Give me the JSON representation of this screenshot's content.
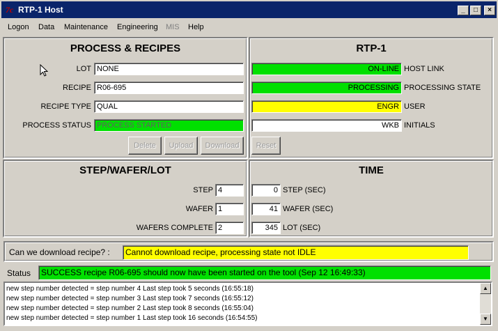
{
  "window": {
    "title": "RTP-1 Host",
    "icon_text": "7c"
  },
  "menu": [
    "Logon",
    "Data",
    "Maintenance",
    "Engineering",
    "MIS",
    "Help"
  ],
  "process": {
    "heading": "PROCESS & RECIPES",
    "lot_label": "LOT",
    "lot_value": "NONE",
    "recipe_label": "RECIPE",
    "recipe_value": "R06-695",
    "recipe_type_label": "RECIPE TYPE",
    "recipe_type_value": "QUAL",
    "status_label": "PROCESS STATUS",
    "status_value": "PROCESS STARTED",
    "delete": "Delete",
    "upload": "Upload",
    "download": "Download"
  },
  "rtp": {
    "heading": "RTP-1",
    "host_link_value": "ON-LINE",
    "host_link_label": "HOST LINK",
    "proc_state_value": "PROCESSING",
    "proc_state_label": "PROCESSING STATE",
    "user_value": "ENGR",
    "user_label": "USER",
    "initials_value": "WKB",
    "initials_label": "INITIALS",
    "reset": "Reset"
  },
  "step": {
    "heading": "STEP/WAFER/LOT",
    "step_label": "STEP",
    "step_value": "4",
    "wafer_label": "WAFER",
    "wafer_value": "1",
    "complete_label": "WAFERS COMPLETE",
    "complete_value": "2"
  },
  "time": {
    "heading": "TIME",
    "step_value": "0",
    "step_label": "STEP (SEC)",
    "wafer_value": "41",
    "wafer_label": "WAFER (SEC)",
    "lot_value": "345",
    "lot_label": "LOT (SEC)"
  },
  "download_question": {
    "label": "Can we download recipe? :",
    "value": "Cannot download recipe, processing state not IDLE"
  },
  "status": {
    "label": "Status",
    "value": "SUCCESS recipe R06-695 should now have been started on the tool (Sep 12 16:49:33)"
  },
  "log": [
    "new step number detected = step number 4  Last step took 5 seconds (16:55:18)",
    "new step number detected = step number 3  Last step took 7 seconds (16:55:12)",
    "new step number detected = step number 2  Last step took 8 seconds (16:55:04)",
    "new step number detected = step number 1  Last step took 16 seconds (16:54:55)"
  ],
  "colors": {
    "green": "#00e000",
    "yellow": "#ffff00",
    "titlebar": "#0a246a"
  }
}
